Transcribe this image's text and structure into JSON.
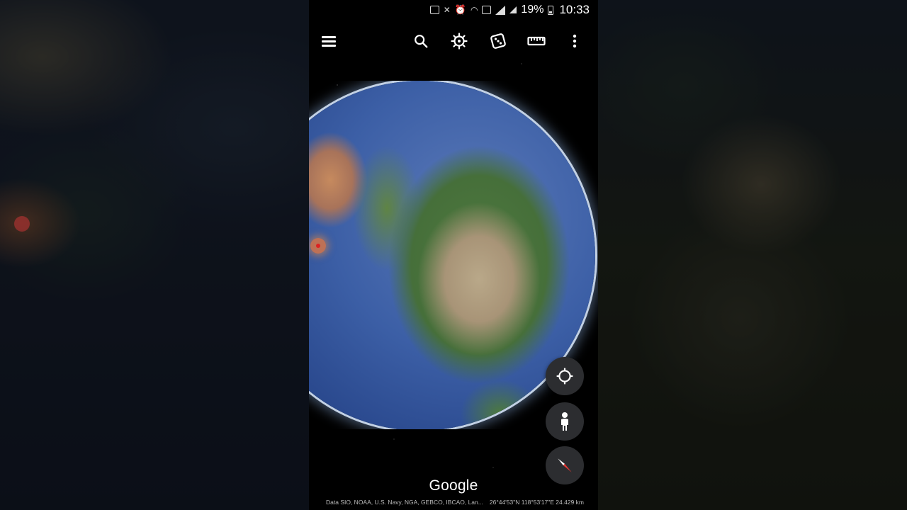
{
  "status_bar": {
    "battery_percent": "19%",
    "time": "10:33",
    "icons": [
      "nfc-icon",
      "mute-icon",
      "alarm-icon",
      "wifi-icon",
      "sim-icon",
      "signal-icon",
      "signal-2-icon",
      "battery-icon"
    ]
  },
  "toolbar": {
    "icons": [
      "menu-icon",
      "search-icon",
      "voyager-icon",
      "feeling-lucky-icon",
      "measure-icon",
      "more-options-icon"
    ]
  },
  "map": {
    "attribution": "Data SIO, NOAA, U.S. Navy, NGA, GEBCO, IBCAO, Lan...",
    "coordinates": "26°44'53\"N 118°53'17\"E 24.429 km"
  },
  "fabs": {
    "icons": [
      "my-location-icon",
      "pegman-icon",
      "compass-icon"
    ]
  },
  "logo": "Google",
  "colors": {
    "fab_background": "#2c2d30",
    "ocean": "#2b4a8f",
    "compass_needle": "#e53935"
  }
}
